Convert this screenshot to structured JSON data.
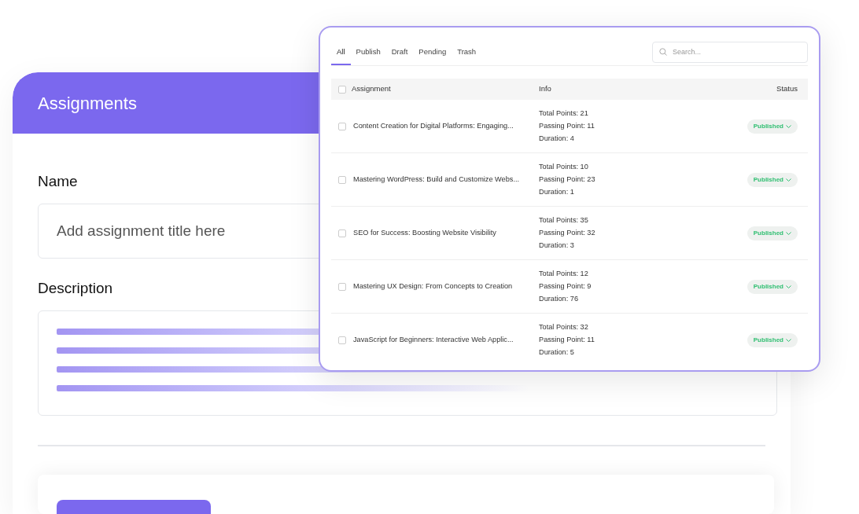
{
  "form": {
    "title": "Assignments",
    "name_field": {
      "label": "Name",
      "placeholder": "Add assignment title here"
    },
    "description_field": {
      "label": "Description"
    }
  },
  "list_panel": {
    "tabs": [
      {
        "label": "All",
        "selected": true
      },
      {
        "label": "Publish",
        "selected": false
      },
      {
        "label": "Draft",
        "selected": false
      },
      {
        "label": "Pending",
        "selected": false
      },
      {
        "label": "Trash",
        "selected": false
      }
    ],
    "search": {
      "placeholder": "Search..."
    },
    "select_all": {
      "checked": false
    },
    "columns": [
      "Assignment",
      "Info",
      "Status"
    ],
    "rows": [
      {
        "checked": false,
        "title": "Content Creation for Digital Platforms: Engaging...",
        "info": [
          "Total Points: 21",
          "Passing Point: 11",
          "Duration: 4"
        ],
        "status": "Published"
      },
      {
        "checked": false,
        "title": "Mastering WordPress: Build and Customize Webs...",
        "info": [
          "Total Points: 10",
          "Passing Point: 23",
          "Duration: 1"
        ],
        "status": "Published"
      },
      {
        "checked": false,
        "title": "SEO for Success: Boosting Website Visibility",
        "info": [
          "Total Points: 35",
          "Passing Point: 32",
          "Duration: 3"
        ],
        "status": "Published"
      },
      {
        "checked": false,
        "title": "Mastering UX Design: From Concepts to Creation",
        "info": [
          "Total Points: 12",
          "Passing Point: 9",
          "Duration: 76"
        ],
        "status": "Published"
      },
      {
        "checked": false,
        "title": "JavaScript for Beginners: Interactive Web Applic...",
        "info": [
          "Total Points: 32",
          "Passing Point: 11",
          "Duration: 5"
        ],
        "status": "Published"
      }
    ]
  }
}
